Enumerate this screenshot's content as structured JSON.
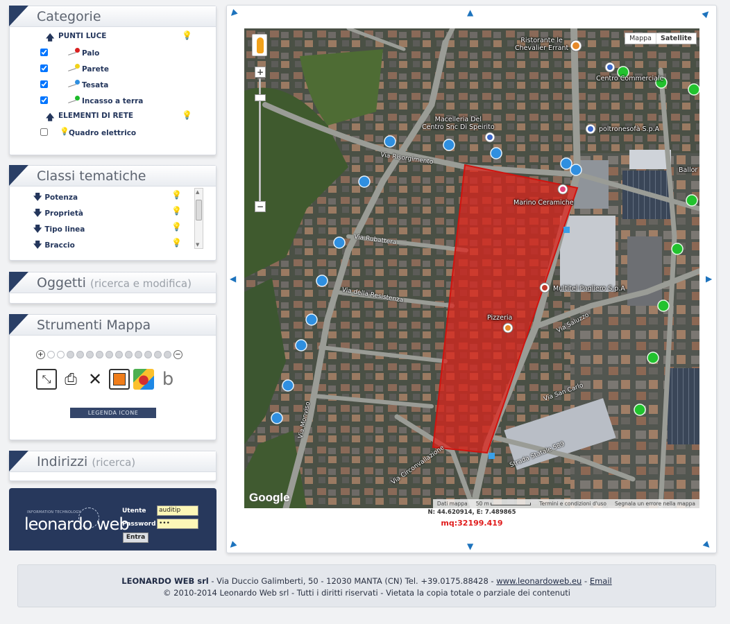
{
  "categorie": {
    "title": "Categorie",
    "groups": [
      {
        "label": "PUNTI LUCE",
        "items": [
          {
            "label": "Palo",
            "checked": true,
            "color": "#d92020"
          },
          {
            "label": "Parete",
            "checked": true,
            "color": "#f1d21a"
          },
          {
            "label": "Tesata",
            "checked": true,
            "color": "#2f8fe0"
          },
          {
            "label": "Incasso a terra",
            "checked": true,
            "color": "#1dbb2a"
          }
        ]
      },
      {
        "label": "ELEMENTI DI RETE",
        "items": [
          {
            "label": "Quadro elettrico",
            "checked": false,
            "color": "#f1d21a"
          }
        ]
      }
    ]
  },
  "classi": {
    "title": "Classi tematiche",
    "items": [
      "Potenza",
      "Proprietà",
      "Tipo linea",
      "Braccio"
    ]
  },
  "oggetti": {
    "title": "Oggetti",
    "subtitle": "(ricerca e modifica)"
  },
  "strumenti": {
    "title": "Strumenti Mappa",
    "legenda": "LEGENDA  ICONE"
  },
  "indirizzi": {
    "title": "Indirizzi",
    "subtitle": "(ricerca)"
  },
  "login": {
    "logo": "leonardo web",
    "logo_small": "INFORMATION TECHNOLOGY",
    "user_label": "Utente",
    "user_value": "auditip",
    "password_label": "Password",
    "password_value": "•••",
    "submit": "Entra"
  },
  "map": {
    "type_map": "Mappa",
    "type_satellite": "Satellite",
    "google": "Google",
    "attribution": [
      "Dati mappa",
      "50 m",
      "Termini e condizioni d'uso",
      "Segnala un errore nella mappa"
    ],
    "poi": [
      {
        "label": "Ristorante le\nChevalier Errant",
        "key": "poi_ristorante"
      },
      {
        "label": "Centro Commerciale",
        "key": "poi_centro"
      },
      {
        "label": "Macelleria Del\nCentro Snc Di Speirito",
        "key": "poi_macelleria"
      },
      {
        "label": "poltronesofà S.p.A",
        "key": "poi_poltrone"
      },
      {
        "label": "Marino Ceramiche",
        "key": "poi_marino"
      },
      {
        "label": "Multitel Pagliero S.p.A",
        "key": "poi_multitel"
      },
      {
        "label": "Ballor",
        "key": "poi_ballor"
      },
      {
        "label": "Pizzeria",
        "key": "poi_pizzeria"
      }
    ],
    "roads": [
      "Via Risorgimento",
      "Via Rubattera",
      "Via della Resistenza",
      "Via Saluzzo",
      "Via San Carlo",
      "Strada Statale 589",
      "Via Monviso",
      "Via Circonvallazione"
    ],
    "coords": "N: 44.620914, E: 7.489865",
    "area": "mq:32199.419"
  },
  "footer": {
    "company": "LEONARDO WEB srl",
    "address": " - Via Duccio Galimberti, 50 - 12030 MANTA (CN) Tel. +39.0175.88428 - ",
    "website": "www.leonardoweb.eu",
    "sep": " - ",
    "email": "Email",
    "copyright": "© 2010-2014 Leonardo Web srl - Tutti i diritti riservati - Vietata la copia totale o parziale dei contenuti"
  }
}
